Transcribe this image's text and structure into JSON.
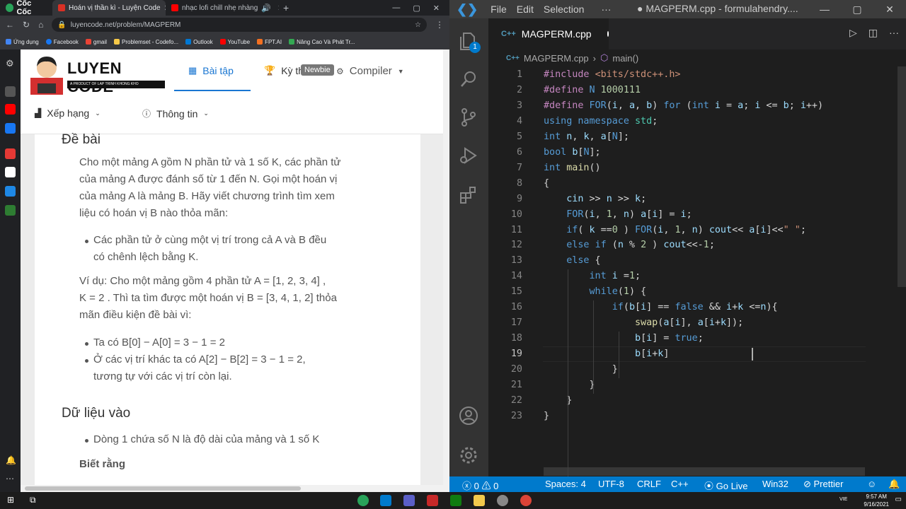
{
  "browser": {
    "brand": "Cốc Cốc",
    "tabs": [
      {
        "title": "Hoán vị thần kì - Luyện Code",
        "active": true
      },
      {
        "title": "nhạc lofi chill nhẹ nhàng",
        "active": false
      }
    ],
    "url": "luyencode.net/problem/MAGPERM",
    "bookmarks": [
      "Ứng dụng",
      "Facebook",
      "gmail",
      "Problemset - Codefo...",
      "Outlook",
      "YouTube",
      "FPT.AI",
      "Nâng Cao Và Phát Tr..."
    ]
  },
  "site": {
    "logo_title": "LUYEN CODE",
    "logo_tagline": "A PRODUCT OF LAP TRINH KHONG KHO",
    "nav": {
      "exercises": "Bài tập",
      "contest": "Kỳ thi",
      "compiler": "Compiler",
      "ranking": "Xếp hạng",
      "info": "Thông tin"
    },
    "tooltip": "Newbie"
  },
  "problem": {
    "heading_statement": "Đề bài",
    "para1_lines": [
      "Cho một mảng A gồm N phần tử và 1 số K, các phần tử",
      "của mảng A được đánh số từ 1 đến N. Gọi một hoán vị",
      "của mảng A là mảng B. Hãy viết chương trình tìm xem",
      "liệu có hoán vị B nào thỏa mãn:"
    ],
    "bullet1_lines": [
      "Các phần tử ở cùng một vị trí trong cả A và B đều",
      "có chênh lệch bằng K."
    ],
    "example_lines": [
      "Ví dụ: Cho một mảng gồm 4 phần tử A = [1, 2, 3, 4] ,",
      "K = 2 . Thì ta tìm được một hoán vị B = [3, 4, 1, 2] thỏa",
      "mãn điều kiện đề bài vì:"
    ],
    "bullet2": "Ta có B[0] − A[0] = 3 − 1 = 2",
    "bullet3_lines": [
      "Ở các vị trí khác ta có A[2] − B[2] = 3 − 1 = 2,",
      "tương tự với các vị trí còn lại."
    ],
    "heading_input": "Dữ liệu vào",
    "bullet4": "Dòng 1 chứa số N là độ dài của mảng và 1 số K",
    "bold_note": "Biết rằng"
  },
  "vscode": {
    "menu": [
      "File",
      "Edit",
      "Selection",
      "···"
    ],
    "title": "● MAGPERM.cpp - formulahendry....",
    "tab_label": "MAGPERM.cpp",
    "tab_icon": "C++",
    "breadcrumb_file": "MAGPERM.cpp",
    "breadcrumb_symbol": "main()",
    "badge": "1",
    "current_line": 19,
    "code": [
      "#include <bits/stdc++.h>",
      "#define N 1000111",
      "#define FOR(i, a, b) for (int i = a; i <= b; i++)",
      "using namespace std;",
      "int n, k, a[N];",
      "bool b[N];",
      "int main()",
      "{",
      "    cin >> n >> k;",
      "    FOR(i, 1, n) a[i] = i;",
      "    if( k ==0 ) FOR(i, 1, n) cout<< a[i]<<\" \";",
      "    else if (n % 2 ) cout<<-1;",
      "    else {",
      "        int i =1;",
      "        while(1) {",
      "            if(b[i] == false && i+k <=n){",
      "                swap(a[i], a[i+k]);",
      "                b[i] = true;",
      "                b[i+k] ",
      "            }",
      "        }",
      "    }",
      "}"
    ],
    "status": {
      "errors": "0",
      "warnings": "0",
      "spaces": "Spaces: 4",
      "encoding": "UTF-8",
      "eol": "CRLF",
      "language": "C++",
      "golive": "Go Live",
      "platform": "Win32",
      "prettier": "Prettier"
    }
  },
  "taskbar": {
    "time": "9:57 AM",
    "date": "9/16/2021",
    "lang": "VIE"
  }
}
